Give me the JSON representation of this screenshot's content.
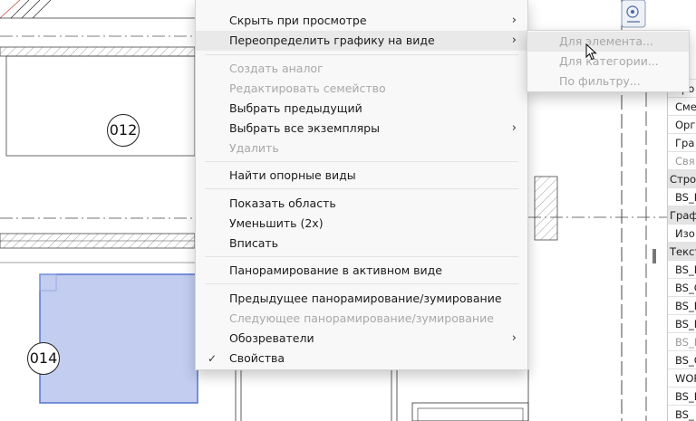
{
  "drawing": {
    "tags": [
      {
        "label": "012"
      },
      {
        "label": "014"
      }
    ]
  },
  "context_menu": {
    "items": [
      {
        "label": "Скрыть при просмотре",
        "disabled": false,
        "submenu": true
      },
      {
        "label": "Переопределить графику на виде",
        "disabled": false,
        "submenu": true,
        "highlighted": true
      },
      {
        "label": "Создать аналог",
        "disabled": true
      },
      {
        "label": "Редактировать семейство",
        "disabled": true
      },
      {
        "label": "Выбрать предыдущий",
        "disabled": false
      },
      {
        "label": "Выбрать все экземпляры",
        "disabled": false,
        "submenu": true
      },
      {
        "label": "Удалить",
        "disabled": true
      },
      {
        "label": "Найти опорные виды",
        "disabled": false
      },
      {
        "label": "Показать область",
        "disabled": false
      },
      {
        "label": "Уменьшить (2x)",
        "disabled": false
      },
      {
        "label": "Вписать",
        "disabled": false
      },
      {
        "label": "Панорамирование в активном виде",
        "disabled": false
      },
      {
        "label": "Предыдущее панорамирование/зумирование",
        "disabled": false
      },
      {
        "label": "Следующее панорамирование/зумирование",
        "disabled": true
      },
      {
        "label": "Обозреватели",
        "disabled": false,
        "submenu": true
      },
      {
        "label": "Свойства",
        "disabled": false,
        "checked": true
      }
    ],
    "submenu_arrow": "›",
    "check_glyph": "✓"
  },
  "submenu": {
    "items": [
      {
        "label": "Для элемента...",
        "disabled": true,
        "highlighted": true
      },
      {
        "label": "Для категории...",
        "disabled": true
      },
      {
        "label": "По фильтру...",
        "disabled": true
      }
    ]
  },
  "properties": {
    "rows": [
      {
        "label": "",
        "type": "sub"
      },
      {
        "label": "Уро",
        "type": "sub"
      },
      {
        "label": "Сме",
        "type": "sub"
      },
      {
        "label": "Орг",
        "type": "sub"
      },
      {
        "label": "Гра",
        "type": "sub"
      },
      {
        "label": "Свя",
        "type": "sub-dis"
      },
      {
        "label": "Стро",
        "type": "grp"
      },
      {
        "label": "BS_E",
        "type": "sub"
      },
      {
        "label": "Граф",
        "type": "grp"
      },
      {
        "label": "Изо",
        "type": "sub"
      },
      {
        "label": "Текст",
        "type": "grp"
      },
      {
        "label": "BS_H",
        "type": "sub"
      },
      {
        "label": "BS_C",
        "type": "sub"
      },
      {
        "label": "BS_I",
        "type": "sub"
      },
      {
        "label": "BS_N",
        "type": "sub"
      },
      {
        "label": "BS_E",
        "type": "sub-dis"
      },
      {
        "label": "BS_C",
        "type": "sub"
      },
      {
        "label": "WOR",
        "type": "sub"
      },
      {
        "label": "BS_D",
        "type": "sub"
      },
      {
        "label": "BS_",
        "type": "sub"
      }
    ]
  },
  "colors": {
    "selection_fill": "#c3cdf0",
    "selection_border": "#5575d0",
    "menu_bg": "#f8f8f8",
    "menu_highlight": "#e9e9e9",
    "disabled_text": "#a8a8a8"
  },
  "icons": [
    "cursor-arrow-icon",
    "navigation-wheel-icon",
    "check-icon",
    "chevron-right-icon"
  ]
}
